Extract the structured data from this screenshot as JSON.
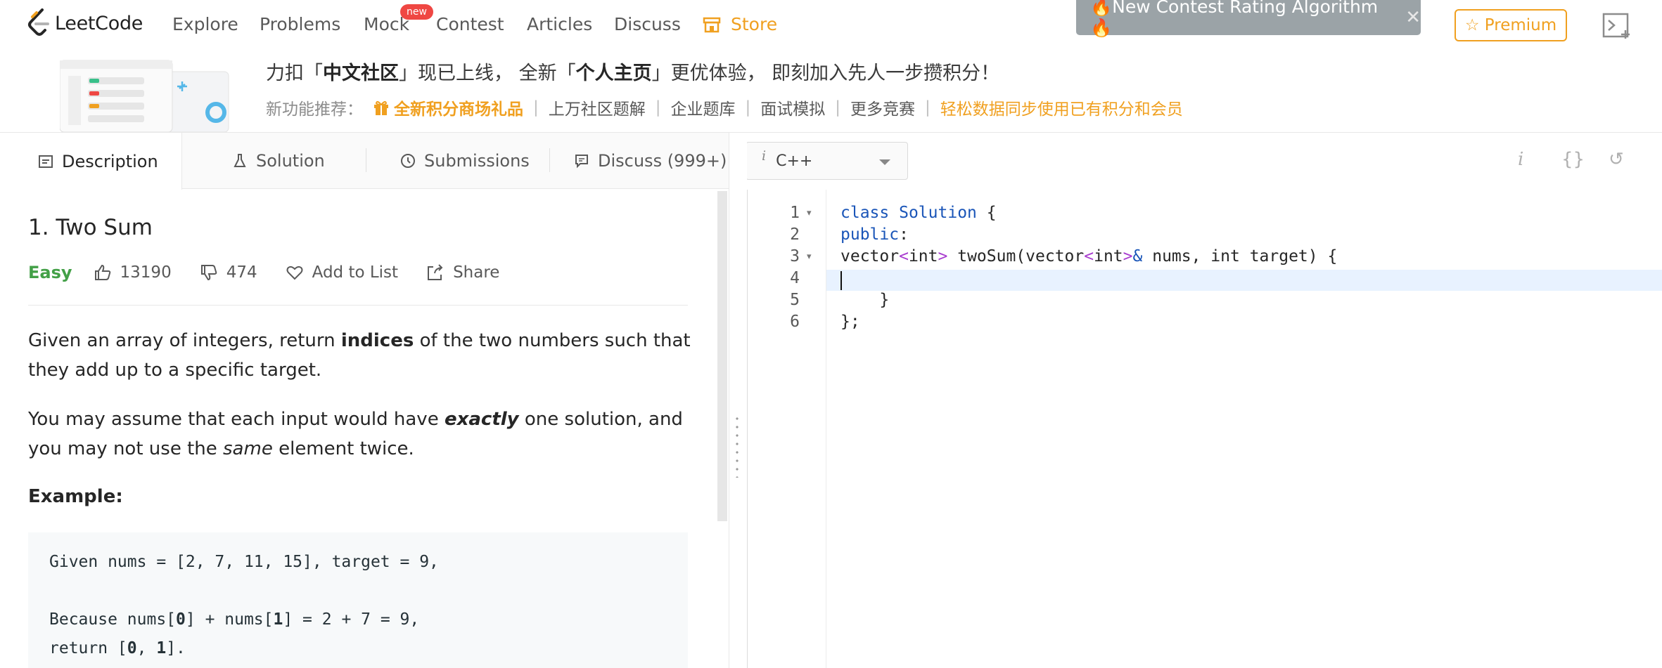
{
  "nav": {
    "logo_text": "LeetCode",
    "links": [
      "Explore",
      "Problems",
      "Mock",
      "Contest",
      "Articles",
      "Discuss"
    ],
    "mock_badge": "new",
    "store_label": "Store",
    "contest_banner": "🔥New Contest Rating Algorithm 🔥",
    "banner_close": "✕",
    "premium_label": "☆ Premium"
  },
  "promo": {
    "title_prefix": "力扣「",
    "title_b1": "中文社区",
    "title_mid": "」现已上线， 全新「",
    "title_b2": "个人主页",
    "title_suffix": "」更优体验， 即刻加入先人一步攒积分！",
    "features_label": "新功能推荐：",
    "feature_highlight": "全新积分商场礼品",
    "features": [
      "上万社区题解",
      "企业题库",
      "面试模拟",
      "更多竞赛"
    ],
    "feature_sep": "|",
    "feature_last": "轻松数据同步使用已有积分和会员"
  },
  "tabs": [
    "Description",
    "Solution",
    "Submissions",
    "Discuss (999+)"
  ],
  "editor": {
    "language": "C++",
    "language_icon": "i",
    "tools": [
      "i",
      "{}",
      "↺"
    ],
    "line_numbers": [
      "1",
      "2",
      "3",
      "4",
      "5",
      "6"
    ],
    "fold_marker": "▾",
    "code": {
      "l1_kw": "class",
      "l1_name": "Solution",
      "l1_brace": "{",
      "l2_kw": "public",
      "l2_colon": ":",
      "l3_a": "vector",
      "l3_lt1": "<",
      "l3_int1": "int",
      "l3_gt1": ">",
      "l3_b": "twoSum(vector",
      "l3_lt2": "<",
      "l3_int2": "int",
      "l3_gt2": ">",
      "l3_amp": "&",
      "l3_c": "nums, int target) {",
      "l5": "}",
      "l6": "};"
    }
  },
  "problem": {
    "title": "1. Two Sum",
    "difficulty": "Easy",
    "likes": "13190",
    "dislikes": "474",
    "add_to_list": "Add to List",
    "share": "Share",
    "p1_a": "Given an array of integers, return ",
    "p1_b": "indices",
    "p1_c": " of the two numbers such that they add up to a specific target.",
    "p2_a": "You may assume that each input would have ",
    "p2_b": "exactly",
    "p2_c": " one solution, and you may not use the ",
    "p2_d": "same",
    "p2_e": " element twice.",
    "example_heading": "Example:",
    "example_line1": "Given nums = [2, 7, 11, 15], target = 9,",
    "example_line3_a": "Because nums[",
    "example_line3_b": "0",
    "example_line3_c": "] + nums[",
    "example_line3_d": "1",
    "example_line3_e": "] = 2 + 7 = 9,",
    "example_line4_a": "return [",
    "example_line4_b": "0",
    "example_line4_c": ", ",
    "example_line4_d": "1",
    "example_line4_e": "]."
  }
}
